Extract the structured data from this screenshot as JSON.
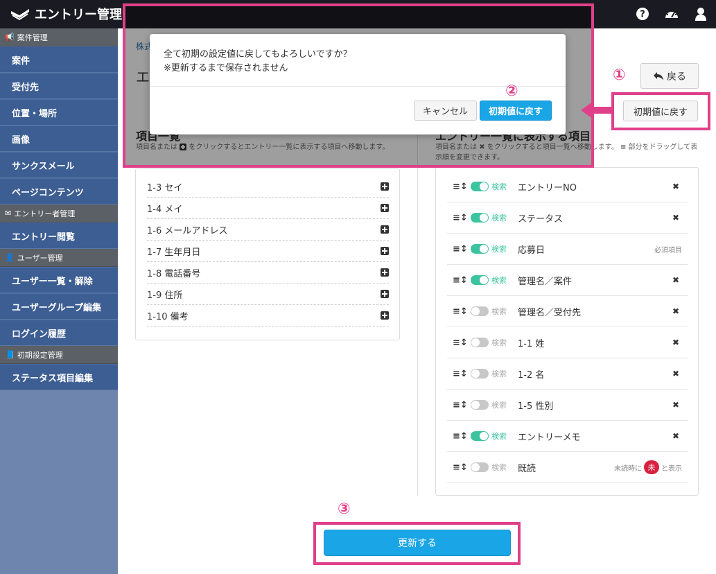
{
  "header": {
    "app_title": "エントリー管理",
    "icons": [
      "help-icon",
      "dashboard-icon",
      "user-icon"
    ]
  },
  "sidebar": {
    "sections": [
      {
        "title": "案件管理",
        "items": [
          "案件",
          "受付先",
          "位置・場所",
          "画像",
          "サンクスメール",
          "ページコンテンツ"
        ]
      },
      {
        "title": "エントリー者管理",
        "items": [
          "エントリー閲覧"
        ]
      },
      {
        "title": "ユーザー管理",
        "items": [
          "ユーザー一覧・解除",
          "ユーザーグループ編集",
          "ログイン履歴"
        ]
      },
      {
        "title": "初期設定管理",
        "items": [
          "ステータス項目編集"
        ]
      }
    ]
  },
  "main": {
    "breadcrumb": "株式",
    "page_title": "エ",
    "back_label": "戻る",
    "reset_label": "初期値に戻す",
    "left": {
      "title": "項目一覧",
      "desc_a": "項目名または",
      "desc_b": "をクリックするとエントリー一覧に表示する項目へ移動します。",
      "items": [
        "1-3 セイ",
        "1-4 メイ",
        "1-6 メールアドレス",
        "1-7 生年月日",
        "1-8 電話番号",
        "1-9 住所",
        "1-10 備考"
      ]
    },
    "right": {
      "title": "エントリー一覧に表示する項目",
      "desc_a": "項目名または",
      "desc_b": "をクリックすると項目一覧へ移動します。",
      "desc_c": "部分をドラッグして表示順を変更できます。",
      "search_label": "検索",
      "required_label": "必須項目",
      "unread_before": "未読時に",
      "unread_badge": "未",
      "unread_after": "と表示",
      "rows": [
        {
          "name": "エントリーNO",
          "search": true,
          "tail": "x"
        },
        {
          "name": "ステータス",
          "search": true,
          "tail": "x"
        },
        {
          "name": "応募日",
          "search": true,
          "tail": "required"
        },
        {
          "name": "管理名／案件",
          "search": true,
          "tail": "x"
        },
        {
          "name": "管理名／受付先",
          "search": false,
          "tail": "x"
        },
        {
          "name": "1-1 姓",
          "search": false,
          "tail": "x"
        },
        {
          "name": "1-2 名",
          "search": false,
          "tail": "x"
        },
        {
          "name": "1-5 性別",
          "search": false,
          "tail": "x"
        },
        {
          "name": "エントリーメモ",
          "search": true,
          "tail": "x"
        },
        {
          "name": "既読",
          "search": false,
          "tail": "unread"
        }
      ]
    },
    "update_label": "更新する"
  },
  "modal": {
    "message_line1": "全て初期の設定値に戻してもよろしいですか？",
    "message_line2": "※更新するまで保存されません",
    "cancel_label": "キャンセル",
    "confirm_label": "初期値に戻す"
  },
  "annotations": {
    "step1": "①",
    "step2": "②",
    "step3": "③",
    "accent_color": "#e0408a"
  },
  "colors": {
    "topbar": "#1a1b22",
    "sidebar_item": "#3d5e93",
    "primary_button": "#1aa5e6",
    "toggle_on": "#3cc4a0"
  }
}
